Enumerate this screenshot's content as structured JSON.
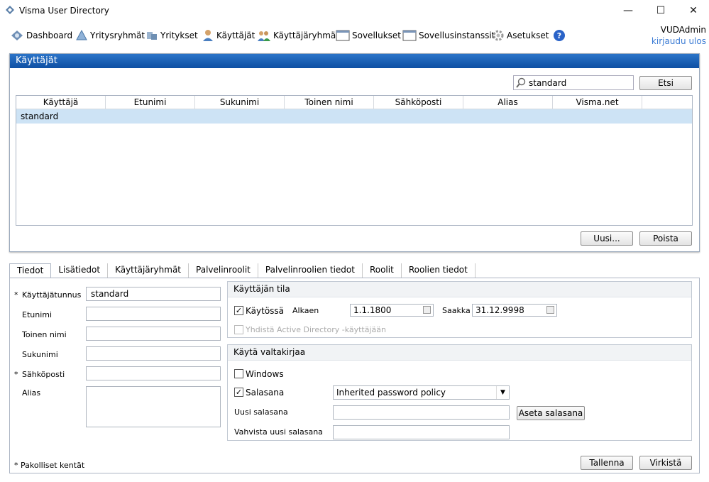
{
  "window": {
    "title": "Visma User Directory",
    "minimize": "—",
    "maximize": "☐",
    "close": "✕"
  },
  "menu": {
    "items": [
      {
        "label": "Dashboard",
        "icon": "dashboard-icon"
      },
      {
        "label": "Yritysryhmät",
        "icon": "company-groups-icon"
      },
      {
        "label": "Yritykset",
        "icon": "companies-icon"
      },
      {
        "label": "Käyttäjät",
        "icon": "user-icon"
      },
      {
        "label": "Käyttäjäryhmät",
        "icon": "user-groups-icon"
      },
      {
        "label": "Sovellukset",
        "icon": "application-icon"
      },
      {
        "label": "Sovellusinstanssit",
        "icon": "application-instance-icon"
      },
      {
        "label": "Asetukset",
        "icon": "gear-icon"
      }
    ],
    "help_icon": "help-icon"
  },
  "user": {
    "name": "VUDAdmin",
    "logout": "kirjaudu ulos"
  },
  "users_panel": {
    "title": "Käyttäjät",
    "search": {
      "value": "standard",
      "button": "Etsi"
    },
    "columns": [
      "Käyttäjä",
      "Etunimi",
      "Sukunimi",
      "Toinen nimi",
      "Sähköposti",
      "Alias",
      "Visma.net"
    ],
    "rows": [
      [
        "standard",
        "",
        "",
        "",
        "",
        "",
        ""
      ]
    ],
    "new_button": "Uusi...",
    "delete_button": "Poista"
  },
  "tabs": [
    "Tiedot",
    "Lisätiedot",
    "Käyttäjäryhmät",
    "Palvelinroolit",
    "Palvelinroolien tiedot",
    "Roolit",
    "Roolien tiedot"
  ],
  "details": {
    "username_label": "Käyttäjätunnus",
    "username_value": "standard",
    "firstname_label": "Etunimi",
    "middlename_label": "Toinen nimi",
    "lastname_label": "Sukunimi",
    "email_label": "Sähköposti",
    "alias_label": "Alias",
    "required_marker": "*",
    "required_note": "* Pakolliset kentät"
  },
  "status_group": {
    "title": "Käyttäjän tila",
    "enabled_label": "Käytössä",
    "enabled": true,
    "from_label": "Alkaen",
    "from_value": "1.1.1800",
    "until_label": "Saakka",
    "until_value": "31.12.9998",
    "ad_label": "Yhdistä Active Directory -käyttäjään"
  },
  "credentials_group": {
    "title": "Käytä valtakirjaa",
    "windows_label": "Windows",
    "windows": false,
    "password_label": "Salasana",
    "password": true,
    "policy_value": "Inherited password policy",
    "new_password_label": "Uusi salasana",
    "set_password_button": "Aseta salasana",
    "confirm_password_label": "Vahvista uusi salasana"
  },
  "footer": {
    "save_button": "Tallenna",
    "refresh_button": "Virkistä"
  }
}
